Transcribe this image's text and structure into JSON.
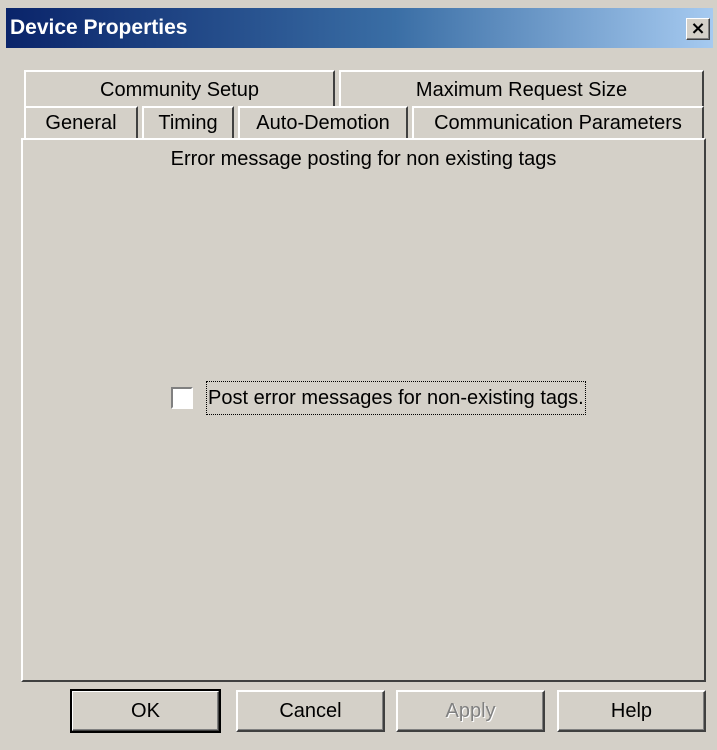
{
  "window": {
    "title": "Device Properties",
    "close_glyph": "×"
  },
  "tabs": {
    "row_back": [
      "Community Setup",
      "Maximum Request Size"
    ],
    "row_front": [
      "General",
      "Timing",
      "Auto-Demotion",
      "Communication Parameters"
    ]
  },
  "panel": {
    "header": "Error message posting for non existing tags",
    "checkbox_label": "Post error messages for non-existing tags.",
    "checkbox_checked": false
  },
  "buttons": {
    "ok": "OK",
    "cancel": "Cancel",
    "apply": "Apply",
    "help": "Help"
  },
  "colors": {
    "face": "#d4d0c8",
    "title_gradient_start": "#0a246a",
    "title_gradient_end": "#a6caf0"
  }
}
